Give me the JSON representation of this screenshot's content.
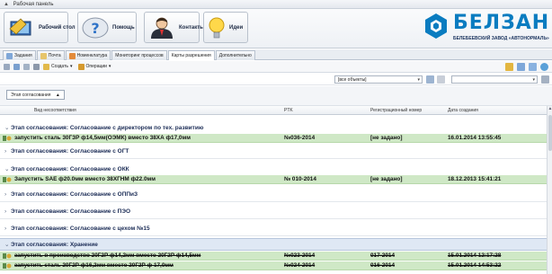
{
  "panel": {
    "caption": "Рабочая панель"
  },
  "ribbon": {
    "buttons": [
      {
        "label": "Рабочий стол"
      },
      {
        "label": "Помощь"
      },
      {
        "label": "Контакты"
      },
      {
        "label": "Идеи"
      }
    ]
  },
  "logo": {
    "brand": "БЕЛЗАН",
    "subtitle": "БЕЛЕБЕЕВСКИЙ ЗАВОД «АВТОНОРМАЛЬ»"
  },
  "tabs": [
    {
      "label": "Задания"
    },
    {
      "label": "Почта"
    },
    {
      "label": "Номенклатура"
    },
    {
      "label": "Мониторинг процессов"
    },
    {
      "label": "Карты разрешения",
      "active": true
    },
    {
      "label": "Дополнительно"
    }
  ],
  "toolbar": {
    "create_label": "Создать",
    "operations_label": "Операции"
  },
  "filter": {
    "objects_value": "[все объекты]"
  },
  "grouping": {
    "chip_label": "Этап согласования"
  },
  "columns": {
    "nonconformity": "Вид несоответствия",
    "ptk": "PTK",
    "regnum": "Регистрационный номер",
    "created": "Дата создания"
  },
  "groups": [
    {
      "title": "Этап согласования:  Согласование с директором по тех. развитию",
      "expanded": true,
      "rows": [
        {
          "text": "запустить сталь 30ГЗР ф14,5мм(ОЭМК) вместо 38ХА ф17,0мм",
          "ptk": "№036-2014",
          "regnum": "[не задано]",
          "created": "16.01.2014 13:55:45",
          "done": false
        }
      ]
    },
    {
      "title": "Этап согласования:  Согласование с ОГТ",
      "expanded": false,
      "rows": []
    },
    {
      "title": "Этап согласования:  Согласование с ОКК",
      "expanded": true,
      "rows": [
        {
          "text": "Запустить SAE ф20.0мм вместо 38ХГНМ ф22.0мм",
          "ptk": "№ 010-2014",
          "regnum": "[не задано]",
          "created": "18.12.2013 15:41:21",
          "done": false
        }
      ]
    },
    {
      "title": "Этап согласования:  Согласование с ОППиЗ",
      "expanded": false,
      "rows": []
    },
    {
      "title": "Этап согласования:  Согласование с ПЭО",
      "expanded": false,
      "rows": []
    },
    {
      "title": "Этап согласования:  Согласование с цехом №15",
      "expanded": false,
      "rows": []
    },
    {
      "title": "Этап согласования:  Хранение",
      "expanded": true,
      "selected": true,
      "rows": [
        {
          "text": "запустить в производство 20Г2Р ф14,2мм вместо 20Г2Р ф14,5мм",
          "ptk": "№023-2014",
          "regnum": "017-2014",
          "created": "15.01.2014 12:17:28",
          "done": true
        },
        {
          "text": "запустить сталь 20Г2Р ф16,2мм вместо 20Г2Р ф 17,0мм",
          "ptk": "№024-2014",
          "regnum": "016-2014",
          "created": "15.01.2014 14:53:22",
          "done": true
        }
      ]
    }
  ]
}
